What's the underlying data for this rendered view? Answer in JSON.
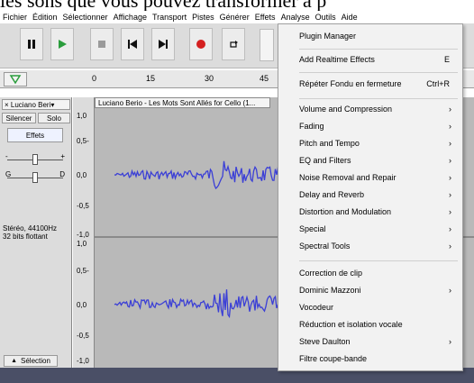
{
  "caption": "les sons que vous pouvez transformer à p",
  "menubar": [
    "Fichier",
    "Édition",
    "Sélectionner",
    "Affichage",
    "Transport",
    "Pistes",
    "Générer",
    "Effets",
    "Analyse",
    "Outils",
    "Aide"
  ],
  "ruler": {
    "ticks": [
      "0",
      "15",
      "30",
      "45"
    ]
  },
  "track": {
    "header": "× Luciano Beri▾",
    "silence": "Silencer",
    "solo": "Solo",
    "effects": "Effets",
    "gain_minus": "-",
    "gain_plus": "+",
    "pan_left": "G",
    "pan_right": "D",
    "info_line1": "Stéréo, 44100Hz",
    "info_line2": "32 bits flottant",
    "select": "Sélection",
    "clip_name": "Luciano Berio - Les Mots Sont Allés for Cello (1..."
  },
  "scale_labels": [
    "1,0",
    "0,5-",
    "0,0",
    "-0,5",
    "-1,0",
    "1,0",
    "0,5-",
    "0,0",
    "-0,5",
    "-1,0"
  ],
  "menu": {
    "plugin_manager": "Plugin Manager",
    "add_realtime": "Add Realtime Effects",
    "add_realtime_shortcut": "E",
    "repeat": "Répéter Fondu en fermeture",
    "repeat_shortcut": "Ctrl+R",
    "volume": "Volume and Compression",
    "fading": "Fading",
    "pitch": "Pitch and Tempo",
    "eq": "EQ and Filters",
    "noise": "Noise Removal and Repair",
    "delay": "Delay and Reverb",
    "distortion": "Distortion and Modulation",
    "special": "Special",
    "spectral": "Spectral Tools",
    "clip_fix": "Correction de clip",
    "dominic": "Dominic Mazzoni",
    "vocoder": "Vocodeur",
    "vocal": "Réduction et isolation vocale",
    "steve": "Steve Daulton",
    "notch": "Filtre coupe-bande",
    "arrow": "›"
  },
  "colors": {
    "wave": "#3b3fd6",
    "menu_bg": "#f2f2f2",
    "bottom_bar": "#4a4f66"
  }
}
